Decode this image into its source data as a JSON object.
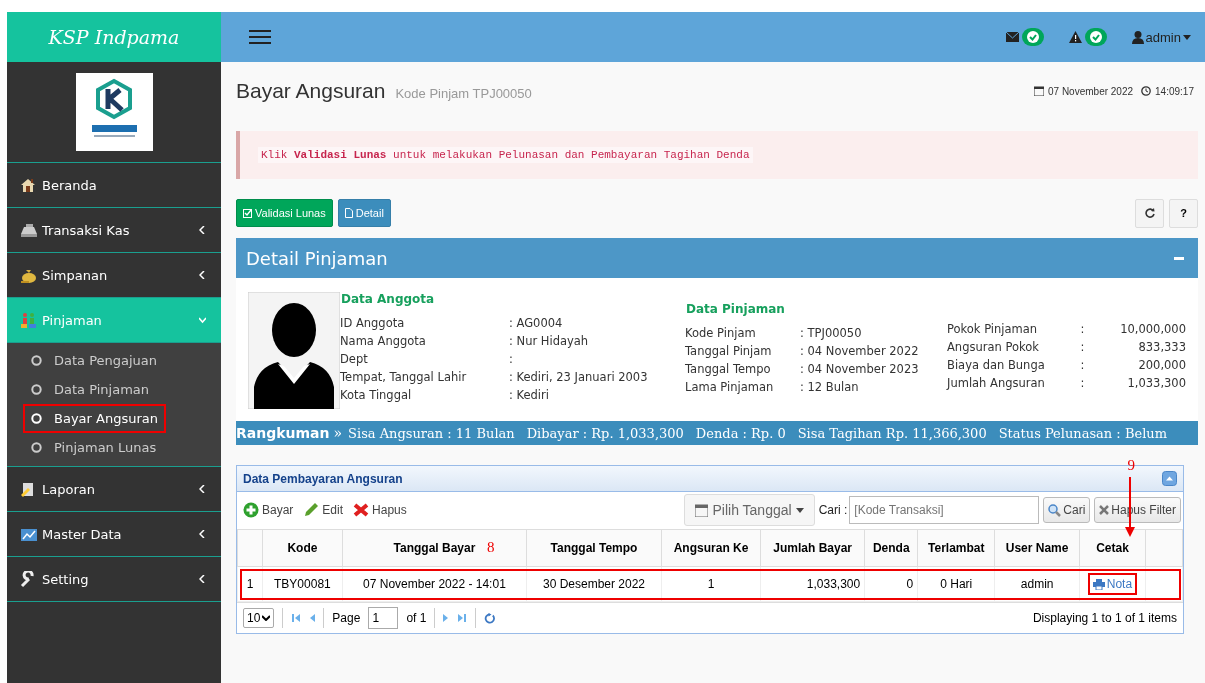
{
  "header": {
    "brand": "KSP Indpama",
    "notifications": [
      {
        "kind": "mail"
      },
      {
        "kind": "warning"
      }
    ],
    "user": "admin"
  },
  "sidebar": {
    "items": [
      {
        "label": "Beranda",
        "expandable": false,
        "expanded": false,
        "selected": false
      },
      {
        "label": "Transaksi Kas",
        "expandable": true,
        "expanded": false,
        "selected": false
      },
      {
        "label": "Simpanan",
        "expandable": true,
        "expanded": false,
        "selected": false
      },
      {
        "label": "Pinjaman",
        "expandable": true,
        "expanded": true,
        "selected": true,
        "children": [
          {
            "label": "Data Pengajuan",
            "selected": false,
            "marked": false
          },
          {
            "label": "Data Pinjaman",
            "selected": false,
            "marked": false
          },
          {
            "label": "Bayar Angsuran",
            "selected": true,
            "marked": true
          },
          {
            "label": "Pinjaman Lunas",
            "selected": false,
            "marked": false
          }
        ]
      },
      {
        "label": "Laporan",
        "expandable": true,
        "expanded": false,
        "selected": false
      },
      {
        "label": "Master Data",
        "expandable": true,
        "expanded": false,
        "selected": false
      },
      {
        "label": "Setting",
        "expandable": true,
        "expanded": false,
        "selected": false
      }
    ]
  },
  "page": {
    "title": "Bayar Angsuran",
    "subtitle": "Kode Pinjam TPJ00050",
    "date": "07 November 2022",
    "time": "14:09:17"
  },
  "alert": "Klik **Validasi Lunas** untuk melakukan Pelunasan dan Pembayaran Tagihan Denda",
  "actions": [
    {
      "label": "Validasi Lunas",
      "kind": "success"
    },
    {
      "label": "Detail",
      "kind": "info"
    }
  ],
  "tools": [
    {
      "kind": "refresh"
    },
    {
      "kind": "help",
      "label": "?"
    }
  ],
  "detail": {
    "title": "Detail Pinjaman",
    "member": {
      "heading": "Data Anggota",
      "fields": [
        {
          "label": "ID Anggota",
          "value": ": AG0004"
        },
        {
          "label": "Nama Anggota",
          "value": ": Nur Hidayah"
        },
        {
          "label": "Dept",
          "value": ":"
        },
        {
          "label": "Tempat, Tanggal Lahir",
          "value": ": Kediri, 23 Januari 2003"
        },
        {
          "label": "Kota Tinggal",
          "value": ": Kediri"
        }
      ]
    },
    "loan": {
      "heading": "Data Pinjaman",
      "fields": [
        {
          "label": "Kode Pinjam",
          "value": ": TPJ00050"
        },
        {
          "label": "Tanggal Pinjam",
          "value": ": 04 November 2022"
        },
        {
          "label": "Tanggal Tempo",
          "value": ": 04 November 2023"
        },
        {
          "label": "Lama Pinjaman",
          "value": ": 12 Bulan"
        }
      ]
    },
    "amounts": [
      {
        "label": "Pokok Pinjaman",
        "colon": ":",
        "value": "10,000,000"
      },
      {
        "label": "Angsuran Pokok",
        "colon": ":",
        "value": "833,333"
      },
      {
        "label": "Biaya dan Bunga",
        "colon": ":",
        "value": "200,000"
      },
      {
        "label": "Jumlah Angsuran",
        "colon": ":",
        "value": "1,033,300"
      }
    ],
    "summary": {
      "heading": "Rangkuman",
      "arrow": "»",
      "items": [
        "Sisa Angsuran : 11 Bulan",
        "Dibayar : Rp. 1,033,300",
        "Denda : Rp. 0",
        "Sisa Tagihan Rp. 11,366,300",
        "Status Pelunasan : Belum"
      ]
    }
  },
  "grid": {
    "title": "Data Pembayaran Angsuran",
    "toolbar": [
      {
        "label": "Bayar",
        "kind": "add"
      },
      {
        "label": "Edit",
        "kind": "edit"
      },
      {
        "label": "Hapus",
        "kind": "delete"
      }
    ],
    "date_button": "Pilih Tanggal",
    "search_label": "Cari :",
    "search": {
      "placeholder": "[Kode Transaksi]"
    },
    "search_button": "Cari",
    "clear_button": "Hapus Filter",
    "columns": [
      "Kode",
      "Tanggal Bayar",
      "Tanggal Tempo",
      "Angsuran Ke",
      "Jumlah Bayar",
      "Denda",
      "Terlambat",
      "User Name",
      "Cetak"
    ],
    "rows": [
      {
        "number": "1",
        "marked": true,
        "cells": [
          "TBY00081",
          "07 November 2022 - 14:01",
          "30 Desember 2022",
          "1",
          "1,033,300",
          "0",
          "0 Hari",
          "admin"
        ],
        "print": {
          "label": "Nota",
          "marked": true
        }
      }
    ],
    "pager": {
      "page_size": "10",
      "page_label": "Page",
      "page": "1",
      "of": "of 1",
      "info": "Displaying 1 to 1 of 1 items"
    },
    "callouts": [
      {
        "label": "8"
      },
      {
        "label": "9"
      }
    ]
  }
}
